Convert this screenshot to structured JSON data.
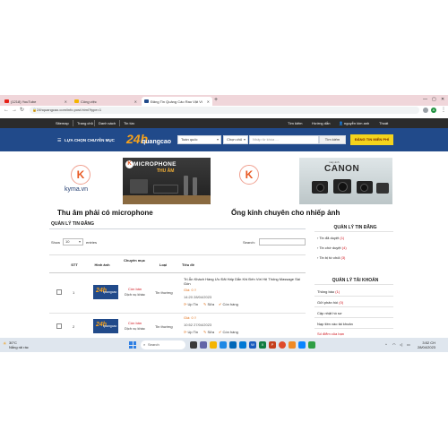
{
  "browser": {
    "tabs": [
      {
        "label": "(1218) YouTube"
      },
      {
        "label": "Công việc"
      },
      {
        "label": "Đăng Tin Quảng Cáo Rao Vặt Vi"
      }
    ],
    "new_tab": "+",
    "url": "24hquangcao.com/info.post.html?type=1",
    "profile_initial": "A"
  },
  "topbar": {
    "links": [
      "Sitemap",
      "Trang chủ",
      "Danh sách",
      "Tin tức"
    ],
    "right_links": [
      "Tìm kiếm",
      "Hướng dẫn",
      "nguyễn kim anh",
      "Thoát"
    ]
  },
  "header": {
    "menu_label": "LỰA CHỌN CHUYÊN MỤC",
    "logo_number": "24h",
    "logo_word": "quangcao",
    "region_select": "Toàn quốc",
    "category_select": "Chọn chủ",
    "keyword_placeholder": "Nhập từ khóa ...",
    "search_button": "Tìm kiếm",
    "post_button": "ĐĂNG TIN MIỄN PHÍ"
  },
  "banners": [
    {
      "brand": "kyma.vn",
      "photo_title": "MICROPHONE",
      "photo_subtitle": "THU ÂM",
      "caption": "Thu âm phải có microphone"
    },
    {
      "photo_small": "máy ảnh",
      "photo_brand": "CANON",
      "caption": "Ống kính chuyên cho nhiếp ảnh"
    }
  ],
  "main": {
    "section_title": "QUẢN LÝ TIN ĐĂNG",
    "show_label": "Show",
    "show_value": "10",
    "entries_label": "entries",
    "search_label": "Search:",
    "columns": [
      "",
      "STT",
      "Hình ảnh",
      "Chuyên mục",
      "Loại",
      "Tiêu đề"
    ],
    "rows": [
      {
        "stt": "1",
        "status": "Còn bán",
        "category": "Dịch vụ khác",
        "type": "Tin thường",
        "title": "Trị Ấn Khách Hàng Ưu Đãi Hấp Dẫn Khi Đến Với Hệ Thống Massage Sài Gòn",
        "price": "Giá: 0 ₫",
        "date": "14:20 28/04/2023",
        "actions": [
          "Up Tin",
          "Sửa",
          "Còn hàng"
        ]
      },
      {
        "stt": "2",
        "status": "Còn bán",
        "category": "Dịch vụ khác",
        "type": "Tin thường",
        "title": "",
        "price": "Giá: 0 ₫",
        "date": "10:52 27/04/2023",
        "actions": [
          "Up Tin",
          "Sửa",
          "Còn hàng"
        ]
      }
    ],
    "thumb_number": "24h",
    "thumb_word": "quangcao"
  },
  "sidebar": {
    "news_title": "QUẢN LÝ TIN ĐĂNG",
    "news_items": [
      {
        "label": "Tin đã duyệt",
        "count": "(1)"
      },
      {
        "label": "Tin chờ duyệt",
        "count": "(4)"
      },
      {
        "label": "Tin bị từ chối",
        "count": "(3)"
      }
    ],
    "account_title": "QUẢN LÝ TÀI KHOẢN",
    "account_items": [
      {
        "label": "Thông báo",
        "count": "(1)"
      },
      {
        "label": "Gửi phản hồi",
        "count": "(0)"
      },
      {
        "label": "Cập nhật hồ sơ",
        "count": ""
      },
      {
        "label": "Nạp tiền vào tài khoản",
        "count": ""
      },
      {
        "label": "Số điểm của bạn",
        "count": ""
      }
    ]
  },
  "taskbar": {
    "temperature": "30°C",
    "weather": "Nắng rải rác",
    "search": "Search",
    "time": "3:52 CH",
    "date": "28/04/2023"
  }
}
